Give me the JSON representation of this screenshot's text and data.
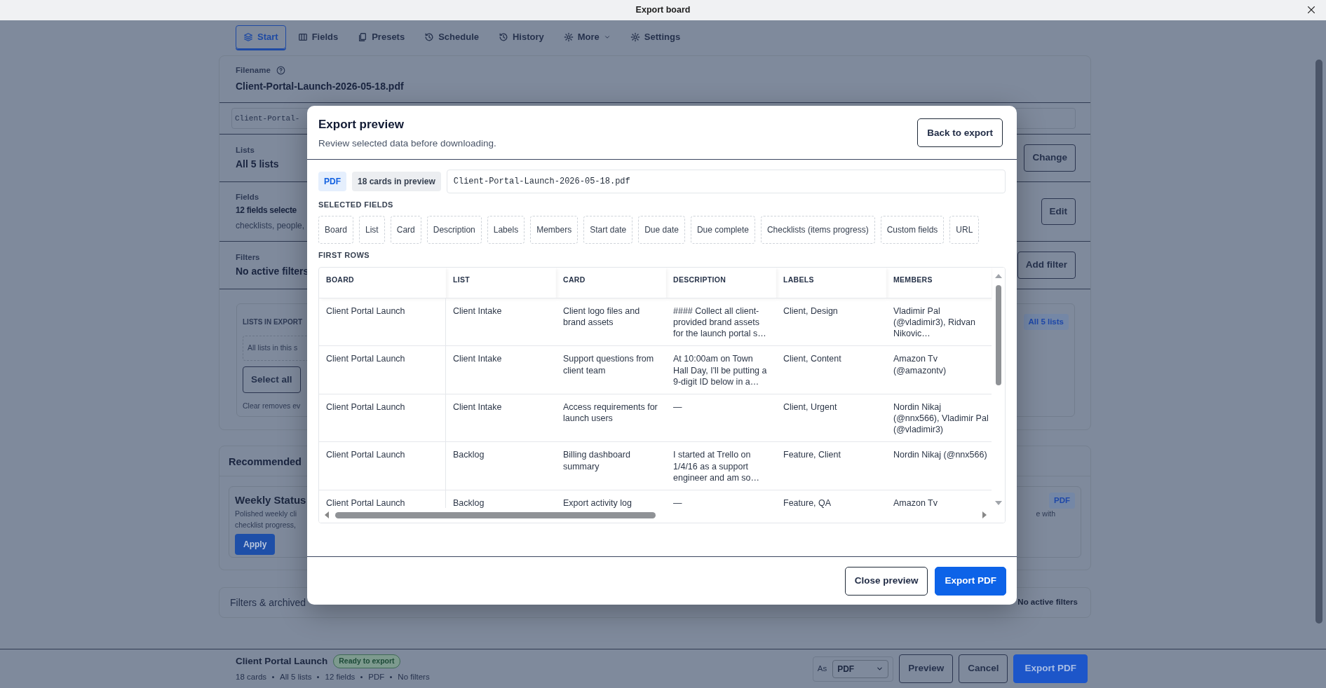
{
  "window": {
    "title": "Export board"
  },
  "tabs": [
    {
      "label": "Start",
      "selected": true,
      "has_menu": false
    },
    {
      "label": "Fields",
      "selected": false,
      "has_menu": false
    },
    {
      "label": "Presets",
      "selected": false,
      "has_menu": false
    },
    {
      "label": "Schedule",
      "selected": false,
      "has_menu": false
    },
    {
      "label": "History",
      "selected": false,
      "has_menu": false
    },
    {
      "label": "More",
      "selected": false,
      "has_menu": true
    },
    {
      "label": "Settings",
      "selected": false,
      "has_menu": false
    }
  ],
  "export_form": {
    "filename": {
      "label": "Filename",
      "value": "Client-Portal-Launch-2026-05-18.pdf",
      "input_value": "Client-Portal-"
    },
    "lists": {
      "label": "Lists",
      "value": "All 5 lists",
      "button": "Change"
    },
    "fields": {
      "label": "Fields",
      "value": "12 fields selecte",
      "hint": "checklists, people,",
      "button": "Edit"
    },
    "filters": {
      "label": "Filters",
      "value": "No active filters",
      "button": "Add filter"
    },
    "lists_in_export": {
      "title": "LISTS IN EXPORT",
      "badge": "All 5 lists",
      "empty_text": "All lists in this s",
      "button": "Select all",
      "hint": "Clear removes ev"
    }
  },
  "recommended": {
    "title": "Recommended",
    "preset": {
      "name": "Weekly Status",
      "description_lines": [
        "Polished weekly cli",
        "checklist progress,"
      ],
      "description_tail": "e with",
      "format": "PDF",
      "button": "Apply"
    }
  },
  "filters_archived": {
    "title": "Filters & archived",
    "summary": "No active filters"
  },
  "footer_bar": {
    "board": "Client Portal Launch",
    "status": "Ready to export",
    "meta": [
      "18 cards",
      "All 5 lists",
      "12 fields",
      "PDF",
      "No filters"
    ],
    "format_label": "As",
    "format": "PDF",
    "buttons": [
      {
        "label": "Preview",
        "primary": false
      },
      {
        "label": "Cancel",
        "primary": false
      },
      {
        "label": "Export PDF",
        "primary": true
      }
    ]
  },
  "modal": {
    "title": "Export preview",
    "subtitle": "Review selected data before downloading.",
    "back_button": "Back to export",
    "format_badge": "PDF",
    "count_badge": "18 cards in preview",
    "filename": "Client-Portal-Launch-2026-05-18.pdf",
    "selected_fields_label": "SELECTED FIELDS",
    "fields": [
      "Board",
      "List",
      "Card",
      "Description",
      "Labels",
      "Members",
      "Start date",
      "Due date",
      "Due complete",
      "Checklists (items progress)",
      "Custom fields",
      "URL"
    ],
    "first_rows_label": "FIRST ROWS",
    "table": {
      "columns": [
        "BOARD",
        "LIST",
        "CARD",
        "DESCRIPTION",
        "LABELS",
        "MEMBERS"
      ],
      "rows": [
        [
          "Client Portal Launch",
          "Client Intake",
          "Client logo files and brand assets",
          "#### Collect all client-provided brand assets for the launch portal s…",
          "Client, Design",
          "Vladimir Pal (@vladimir3), Ridvan Nikovic…"
        ],
        [
          "Client Portal Launch",
          "Client Intake",
          "Support questions from client team",
          "At 10:00am on Town Hall Day, I'll be putting a 9-digit ID below in a…",
          "Client, Content",
          "Amazon Tv (@amazontv)"
        ],
        [
          "Client Portal Launch",
          "Client Intake",
          "Access requirements for launch users",
          "—",
          "Client, Urgent",
          "Nordin Nikaj (@nnx566), Vladimir Pal (@vladimir3)"
        ],
        [
          "Client Portal Launch",
          "Backlog",
          "Billing dashboard summary",
          "I started at Trello on 1/4/16 as a support engineer and am so…",
          "Feature, Client",
          "Nordin Nikaj (@nnx566)"
        ],
        [
          "Client Portal Launch",
          "Backlog",
          "Export activity log",
          "—",
          "Feature, QA",
          "Amazon Tv"
        ]
      ]
    },
    "buttons": [
      {
        "label": "Close preview",
        "primary": false
      },
      {
        "label": "Export PDF",
        "primary": true
      }
    ]
  }
}
